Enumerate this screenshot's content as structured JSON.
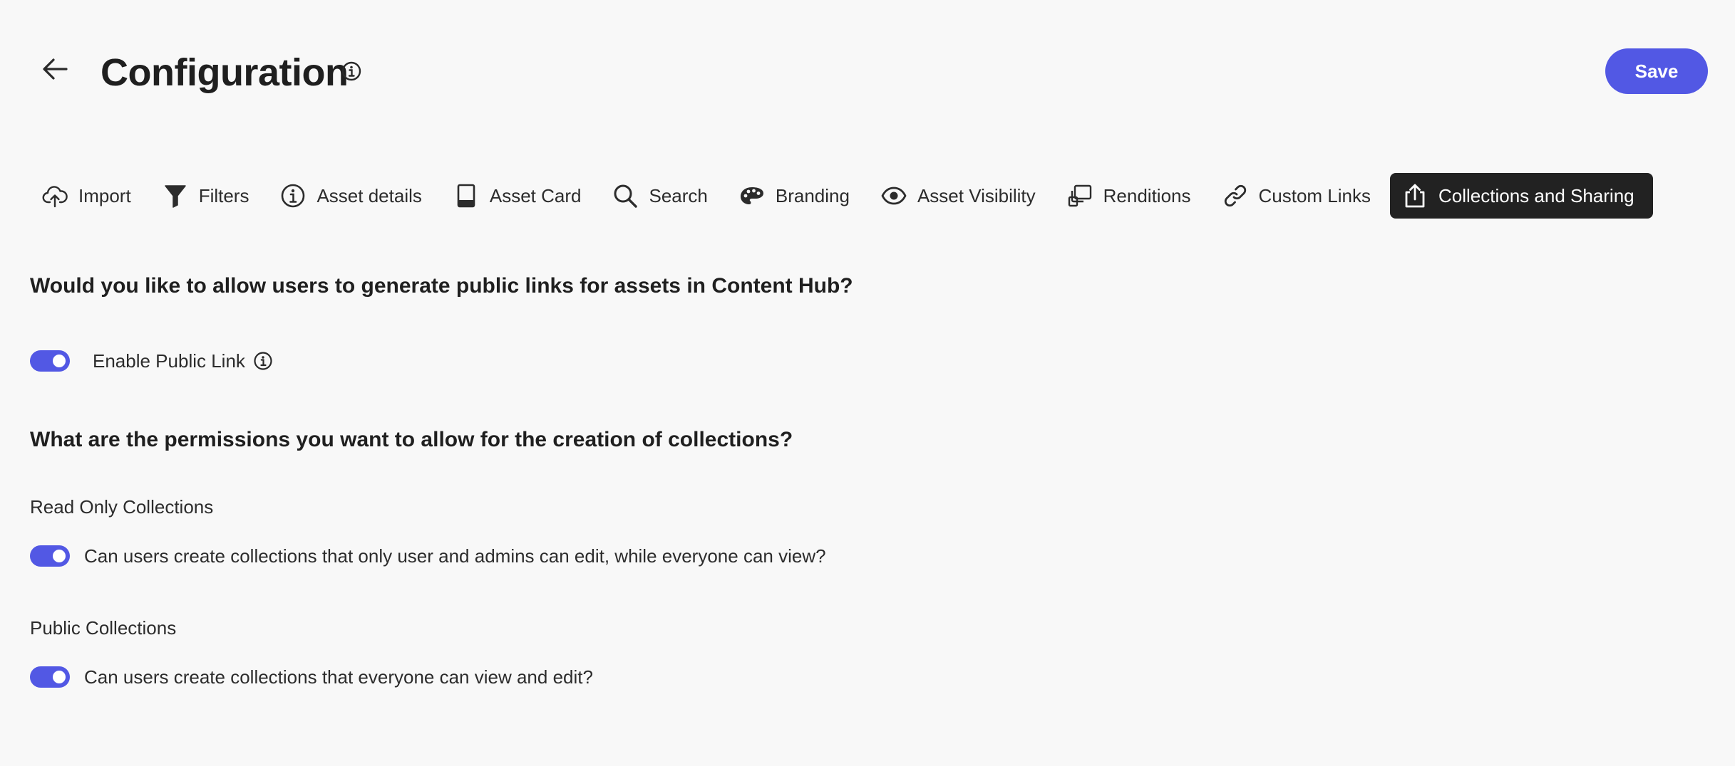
{
  "header": {
    "title": "Configuration",
    "save_label": "Save"
  },
  "tabs": [
    {
      "label": "Import",
      "icon": "cloud-upload-icon",
      "active": false
    },
    {
      "label": "Filters",
      "icon": "filter-icon",
      "active": false
    },
    {
      "label": "Asset details",
      "icon": "info-circle-icon",
      "active": false
    },
    {
      "label": "Asset Card",
      "icon": "card-icon",
      "active": false
    },
    {
      "label": "Search",
      "icon": "search-icon",
      "active": false
    },
    {
      "label": "Branding",
      "icon": "palette-icon",
      "active": false
    },
    {
      "label": "Asset Visibility",
      "icon": "eye-icon",
      "active": false
    },
    {
      "label": "Renditions",
      "icon": "renditions-icon",
      "active": false
    },
    {
      "label": "Custom Links",
      "icon": "link-icon",
      "active": false
    },
    {
      "label": "Collections and Sharing",
      "icon": "share-icon",
      "active": true
    }
  ],
  "public_link": {
    "question": "Would you like to allow users to generate public links for assets in Content Hub?",
    "toggle_label": "Enable Public Link",
    "enabled": true
  },
  "collections": {
    "question": "What are the permissions you want to allow for the creation of collections?",
    "read_only": {
      "title": "Read Only Collections",
      "toggle_label": "Can users create collections that only user and admins can edit, while everyone can view?",
      "enabled": true
    },
    "public": {
      "title": "Public Collections",
      "toggle_label": "Can users create collections that everyone can view and edit?",
      "enabled": true
    }
  },
  "colors": {
    "accent": "#5258e4",
    "active_tab_bg": "#222222",
    "background": "#f8f8f8"
  }
}
